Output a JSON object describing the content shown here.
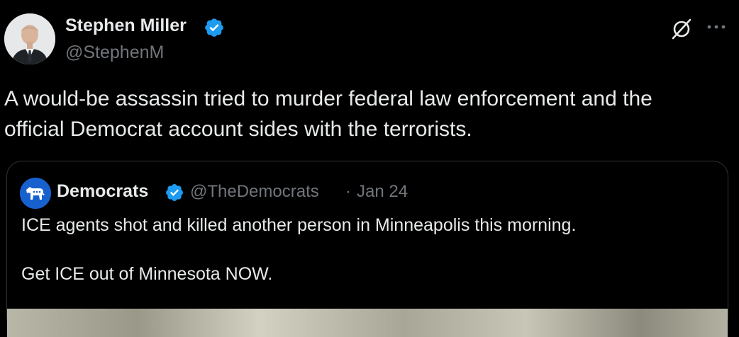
{
  "tweet": {
    "author_name": "Stephen Miller",
    "author_handle": "@StephenM",
    "text_line1": "A would-be assassin tried to murder federal law enforcement and the",
    "text_line2": "official Democrat account sides with the terrorists."
  },
  "quoted": {
    "author_name": "Democrats",
    "author_handle": "@TheDemocrats",
    "separator": "·",
    "date": "Jan 24",
    "text_line1": "ICE agents shot and killed another person in Minneapolis this morning.",
    "text_line2": "Get ICE out of Minnesota NOW."
  },
  "icons": {
    "verified": "verified-badge-icon",
    "grok": "grok-icon",
    "more": "more-icon"
  },
  "colors": {
    "background": "#000000",
    "text_primary": "#e7e9ea",
    "text_secondary": "#71767b",
    "verified_blue": "#1d9bf0",
    "border": "#2f3336",
    "democrats_blue": "#1761ce"
  }
}
